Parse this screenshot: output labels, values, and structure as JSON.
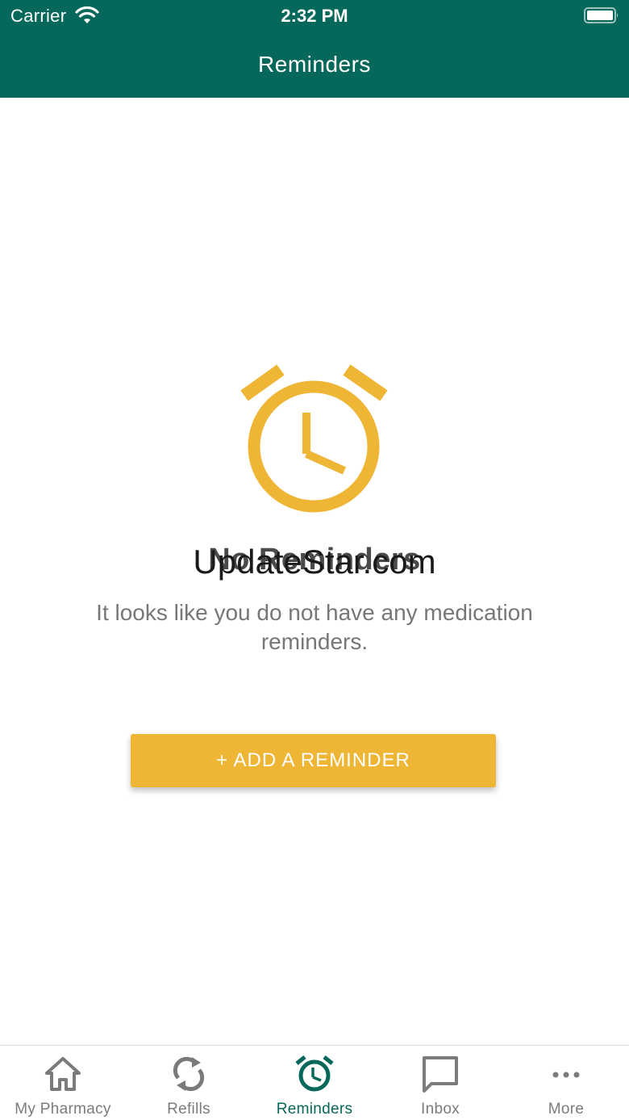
{
  "status_bar": {
    "carrier": "Carrier",
    "time": "2:32 PM",
    "wifi_icon": "wifi-icon",
    "battery_icon": "battery-full-icon"
  },
  "header": {
    "title": "Reminders"
  },
  "empty_state": {
    "icon": "alarm-clock-icon",
    "title": "No Reminders",
    "watermark": "UpdateStar.com",
    "description": "It looks like you do not have any medication reminders."
  },
  "actions": {
    "add_reminder_label": "+ ADD A REMINDER"
  },
  "tab_bar": {
    "active": "Reminders",
    "tabs": [
      {
        "label": "My Pharmacy",
        "icon": "home-icon"
      },
      {
        "label": "Refills",
        "icon": "refresh-icon"
      },
      {
        "label": "Reminders",
        "icon": "alarm-clock-icon"
      },
      {
        "label": "Inbox",
        "icon": "message-icon"
      },
      {
        "label": "More",
        "icon": "more-dots-icon"
      }
    ]
  },
  "colors": {
    "brand_green": "#05685a",
    "accent_yellow": "#efb535",
    "inactive_gray": "#7b7b7b"
  }
}
